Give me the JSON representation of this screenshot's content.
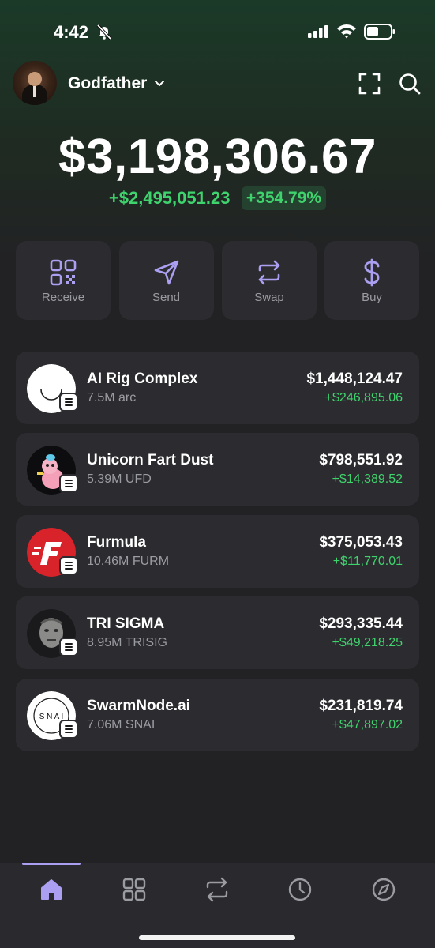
{
  "status_bar": {
    "time": "4:42"
  },
  "header": {
    "account_name": "Godfather"
  },
  "balance": {
    "total": "$3,198,306.67",
    "change_abs": "+$2,495,051.23",
    "change_pct": "+354.79%"
  },
  "actions": [
    {
      "label": "Receive",
      "icon": "qr-code-icon"
    },
    {
      "label": "Send",
      "icon": "send-icon"
    },
    {
      "label": "Swap",
      "icon": "swap-icon"
    },
    {
      "label": "Buy",
      "icon": "dollar-icon"
    }
  ],
  "tokens": [
    {
      "name": "AI Rig Complex",
      "amount": "7.5M arc",
      "value": "$1,448,124.47",
      "gain": "+$246,895.06"
    },
    {
      "name": "Unicorn Fart Dust",
      "amount": "5.39M UFD",
      "value": "$798,551.92",
      "gain": "+$14,389.52"
    },
    {
      "name": "Furmula",
      "amount": "10.46M FURM",
      "value": "$375,053.43",
      "gain": "+$11,770.01"
    },
    {
      "name": "TRI SIGMA",
      "amount": "8.95M TRISIG",
      "value": "$293,335.44",
      "gain": "+$49,218.25"
    },
    {
      "name": "SwarmNode.ai",
      "amount": "7.06M SNAI",
      "value": "$231,819.74",
      "gain": "+$47,897.02",
      "logo_text": "S N A I"
    }
  ],
  "bottom_nav": [
    {
      "icon": "home-icon",
      "active": true
    },
    {
      "icon": "collectibles-grid-icon",
      "active": false
    },
    {
      "icon": "swap-icon",
      "active": false
    },
    {
      "icon": "activity-clock-icon",
      "active": false
    },
    {
      "icon": "explore-compass-icon",
      "active": false
    }
  ],
  "colors": {
    "accent": "#ab9ff2",
    "positive": "#3fd36d",
    "card": "#2c2c30",
    "background": "#222224",
    "muted_text": "#9b9ba2"
  }
}
